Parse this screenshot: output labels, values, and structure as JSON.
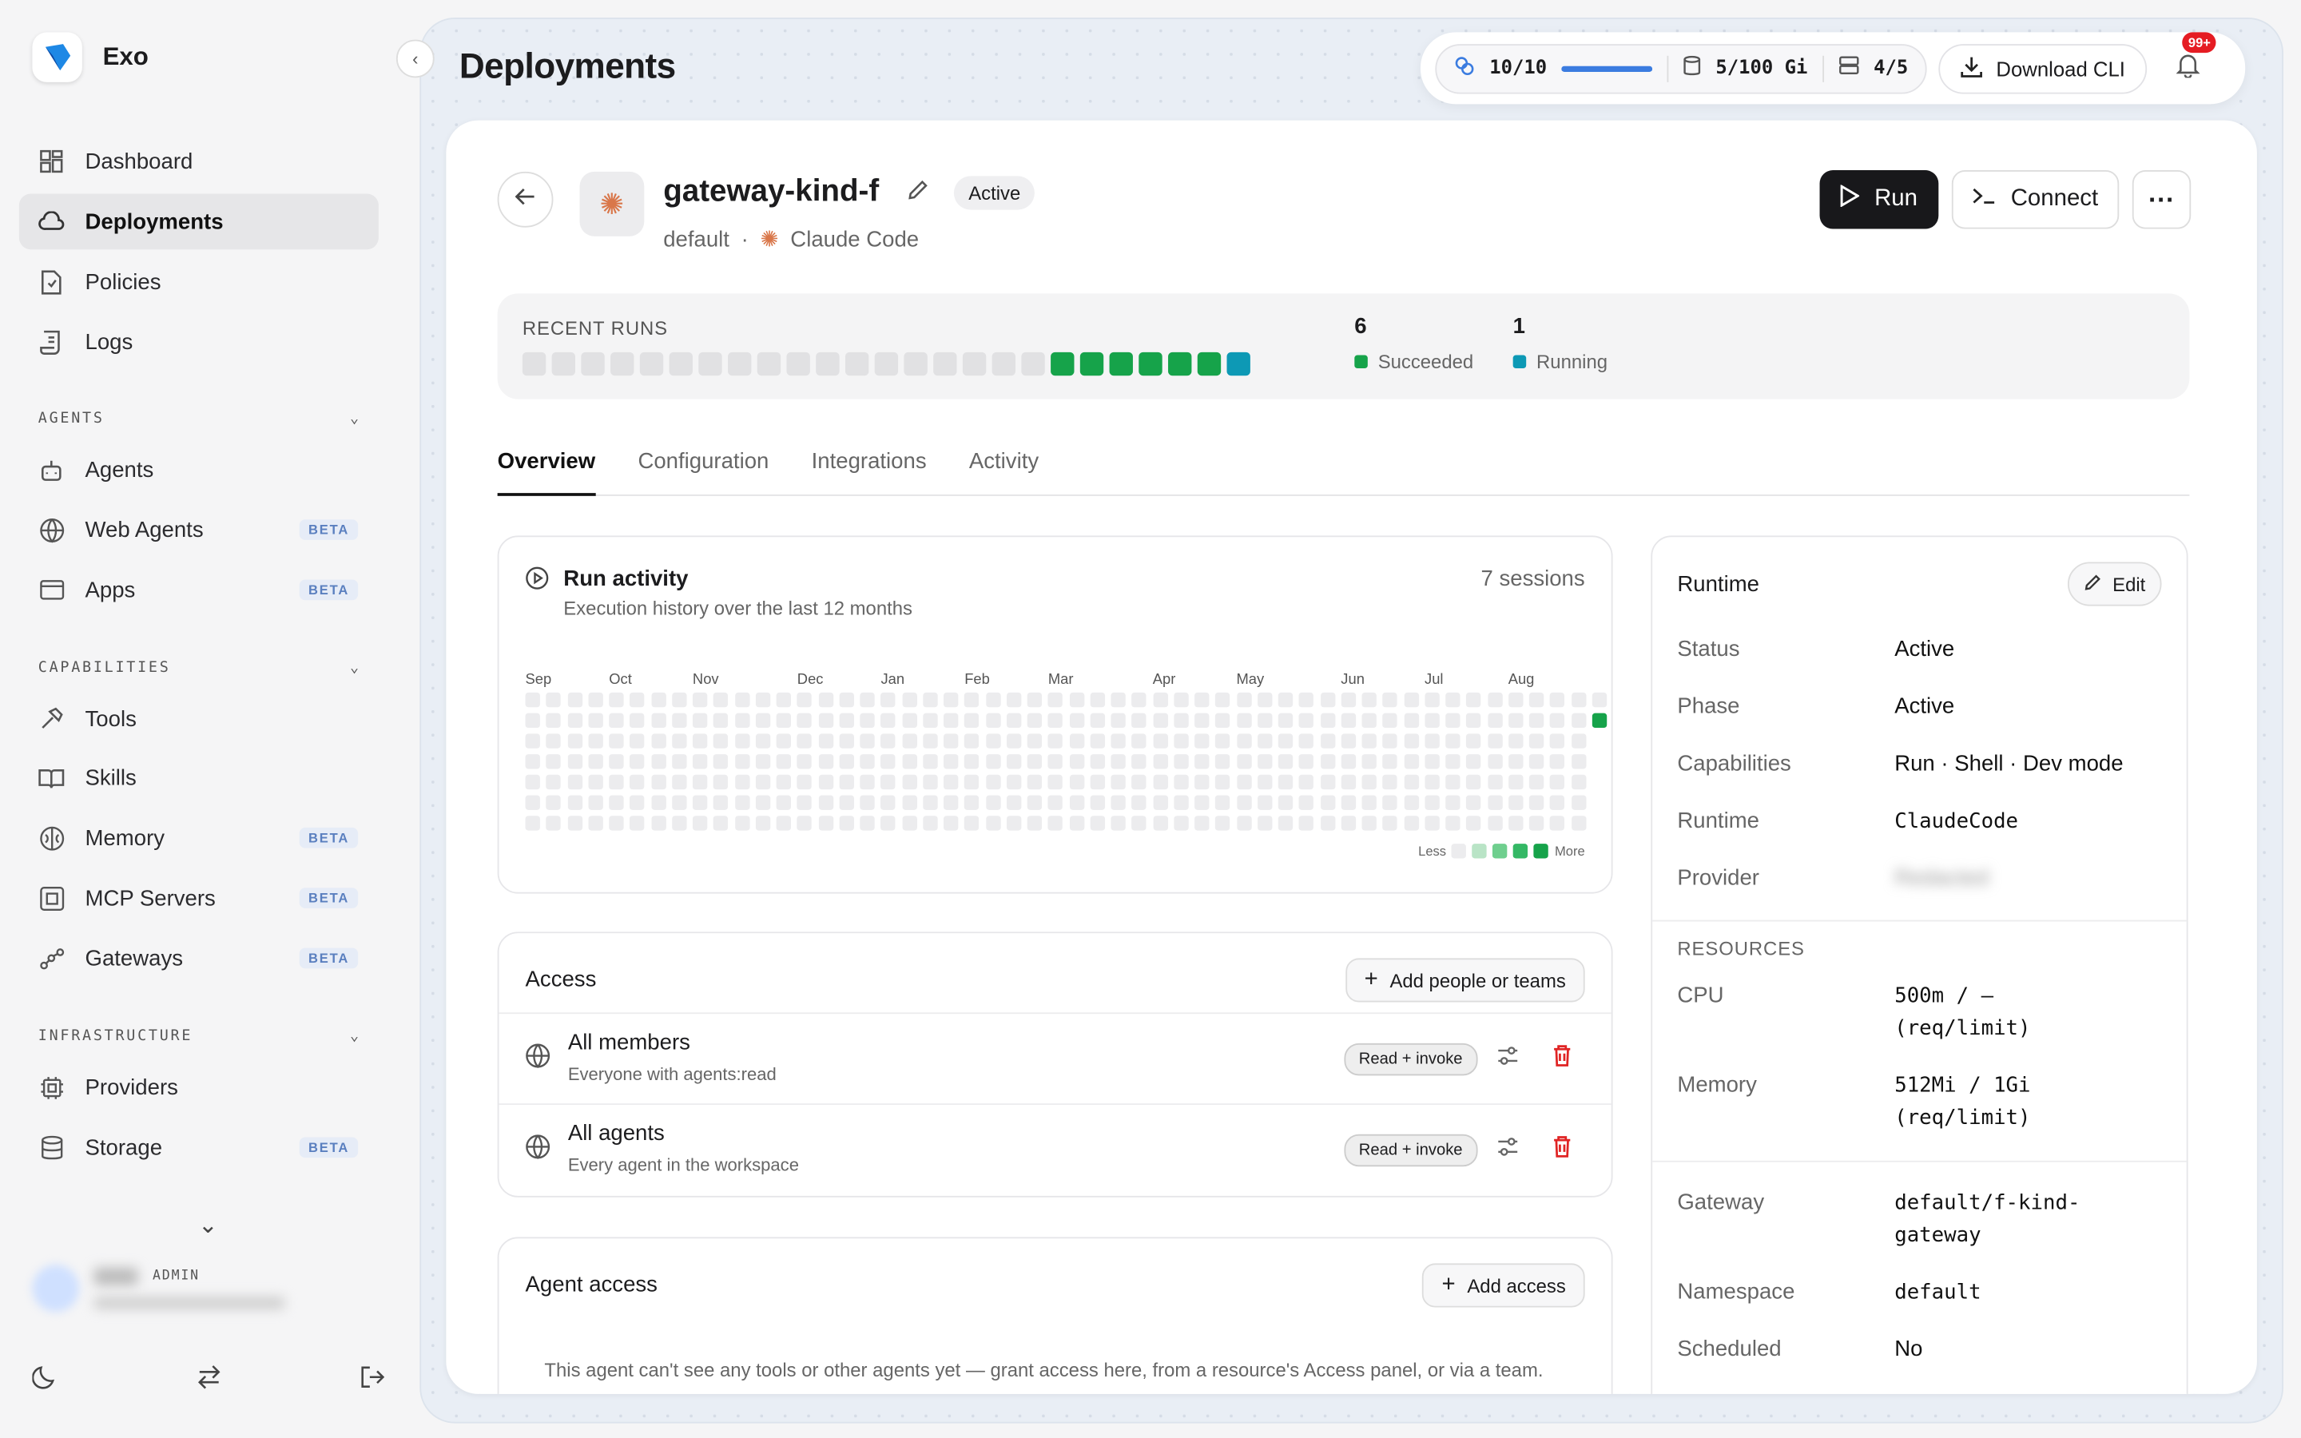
{
  "app": {
    "name": "Exo"
  },
  "sidebar": {
    "main": [
      {
        "label": "Dashboard"
      },
      {
        "label": "Deployments"
      },
      {
        "label": "Policies"
      },
      {
        "label": "Logs"
      }
    ],
    "agents_header": "AGENTS",
    "agents": [
      {
        "label": "Agents",
        "beta": ""
      },
      {
        "label": "Web Agents",
        "beta": "BETA"
      },
      {
        "label": "Apps",
        "beta": "BETA"
      }
    ],
    "capabilities_header": "CAPABILITIES",
    "capabilities": [
      {
        "label": "Tools",
        "beta": ""
      },
      {
        "label": "Skills",
        "beta": ""
      },
      {
        "label": "Memory",
        "beta": "BETA"
      },
      {
        "label": "MCP Servers",
        "beta": "BETA"
      },
      {
        "label": "Gateways",
        "beta": "BETA"
      }
    ],
    "infrastructure_header": "INFRASTRUCTURE",
    "infrastructure": [
      {
        "label": "Providers",
        "beta": ""
      },
      {
        "label": "Storage",
        "beta": "BETA"
      }
    ],
    "user_role": "ADMIN"
  },
  "header": {
    "title": "Deployments",
    "quota_runs": "10/10",
    "quota_runs_progress": 1.0,
    "quota_storage": "5/100 Gi",
    "quota_nodes": "4/5",
    "download_label": "Download CLI",
    "notification_badge": "99+"
  },
  "agent": {
    "name": "gateway-kind-f",
    "status": "Active",
    "namespace": "default",
    "separator": "·",
    "runtime_label": "Claude Code",
    "run_label": "Run",
    "connect_label": "Connect",
    "more": "···"
  },
  "recent_runs": {
    "title": "RECENT RUNS",
    "runs": [
      "e",
      "e",
      "e",
      "e",
      "e",
      "e",
      "e",
      "e",
      "e",
      "e",
      "e",
      "e",
      "e",
      "e",
      "e",
      "e",
      "e",
      "e",
      "s",
      "s",
      "s",
      "s",
      "s",
      "s",
      "r"
    ],
    "succeeded_count": "6",
    "succeeded_label": "Succeeded",
    "running_count": "1",
    "running_label": "Running",
    "colors": {
      "succeeded": "#16a34a",
      "running": "#0d99b5"
    }
  },
  "tabs": [
    {
      "label": "Overview"
    },
    {
      "label": "Configuration"
    },
    {
      "label": "Integrations"
    },
    {
      "label": "Activity"
    }
  ],
  "run_activity": {
    "title": "Run activity",
    "subtitle": "Execution history over the last 12 months",
    "sessions": "7 sessions",
    "months": [
      "Sep",
      "Oct",
      "Nov",
      "Dec",
      "Jan",
      "Feb",
      "Mar",
      "Apr",
      "May",
      "Jun",
      "Jul",
      "Aug"
    ],
    "legend_less": "Less",
    "legend_more": "More",
    "active_week": 51,
    "active_day": 1
  },
  "access": {
    "title": "Access",
    "add_label": "Add people or teams",
    "rows": [
      {
        "title": "All members",
        "subtitle": "Everyone with agents:read",
        "permission": "Read + invoke"
      },
      {
        "title": "All agents",
        "subtitle": "Every agent in the workspace",
        "permission": "Read + invoke"
      }
    ]
  },
  "agent_access": {
    "title": "Agent access",
    "add_label": "Add access",
    "empty": "This agent can't see any tools or other agents yet — grant access here, from a resource's Access panel, or via a team."
  },
  "runtime": {
    "title": "Runtime",
    "edit_label": "Edit",
    "fields": [
      {
        "k": "Status",
        "v": "Active"
      },
      {
        "k": "Phase",
        "v": "Active"
      },
      {
        "k": "Capabilities",
        "v": "Run · Shell · Dev mode"
      },
      {
        "k": "Runtime",
        "v": "ClaudeCode"
      },
      {
        "k": "Provider",
        "v": "Redacted"
      }
    ],
    "resources_header": "RESOURCES",
    "cpu_label": "CPU",
    "cpu_value": "500m / — (req/limit)",
    "memory_label": "Memory",
    "memory_value": "512Mi / 1Gi (req/limit)",
    "gateway_label": "Gateway",
    "gateway_value": "default/f-kind-gateway",
    "namespace_label": "Namespace",
    "namespace_value": "default",
    "scheduled_label": "Scheduled",
    "scheduled_value": "No"
  }
}
